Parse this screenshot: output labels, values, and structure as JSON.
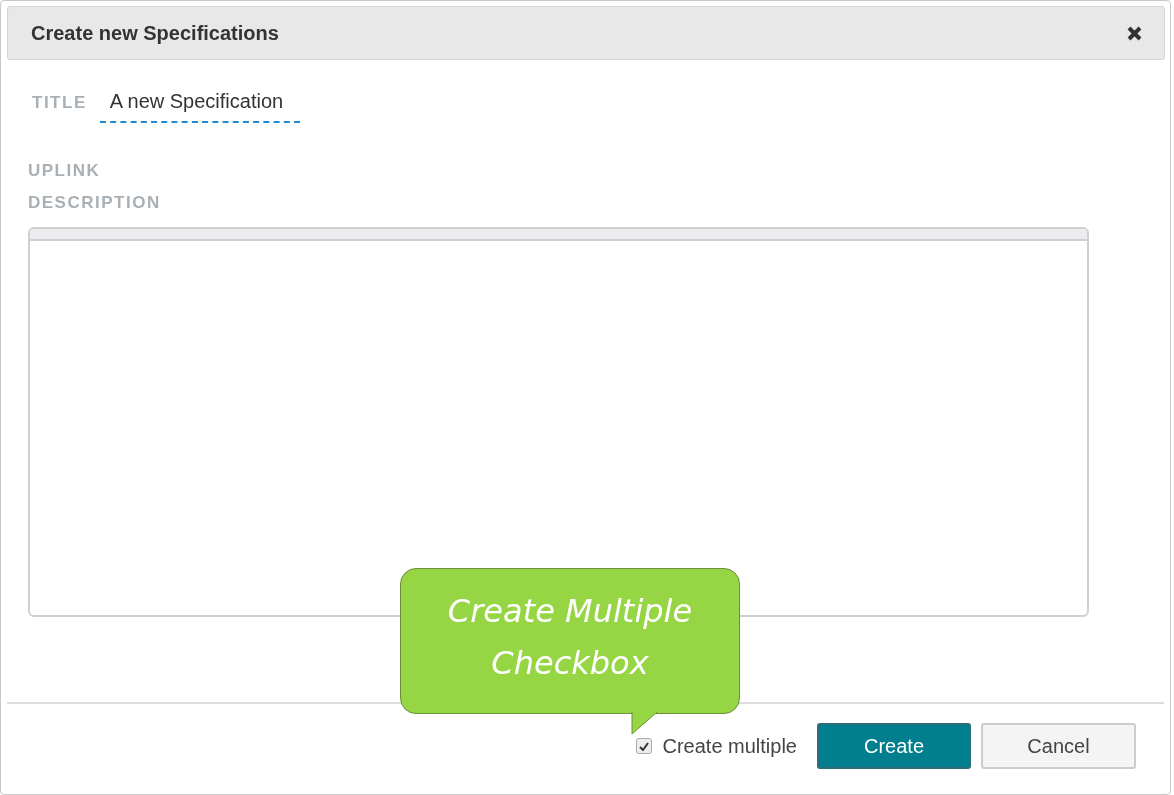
{
  "dialog": {
    "title": "Create new Specifications"
  },
  "fields": [
    {
      "kind": "text",
      "label": "TITLE",
      "value": "A new Specification"
    },
    {
      "kind": "label",
      "label": "UPLINK"
    },
    {
      "kind": "editor",
      "label": "DESCRIPTION"
    }
  ],
  "create_multiple": {
    "label": "Create multiple",
    "checked": true
  },
  "buttons": [
    {
      "label": "Create",
      "kind": "primary"
    },
    {
      "label": "Cancel",
      "kind": "secondary"
    }
  ],
  "callout": {
    "lines": [
      "Create Multiple",
      "Checkbox"
    ]
  }
}
